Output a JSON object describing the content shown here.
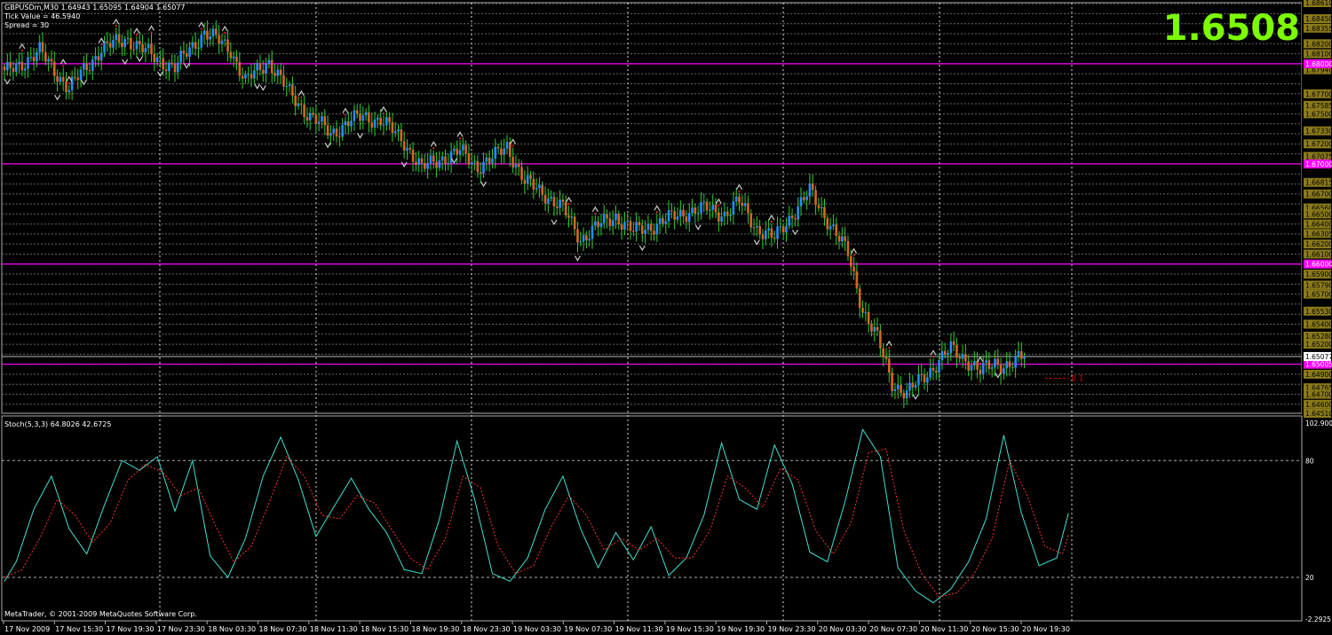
{
  "header": {
    "symbol_line": "GBPUSDm,M30  1.64943 1.65095 1.64904 1.65077",
    "tick_value": "Tick Value = 46.5940",
    "spread": "Spread = 30"
  },
  "big_price": "1.6508",
  "indicator_label": "Stoch(5,3,3) 64.8026 42.6725",
  "copyright": "MetaTrader, © 2001-2009 MetaQuotes Software Corp.",
  "order_label": "0.1",
  "colors": {
    "background": "#000000",
    "bull_candle": "#1E90FF",
    "bear_candle": "#D2691E",
    "wick": "#32CD32",
    "level_line": "#FF00FF",
    "grid": "#666666",
    "stoch_main": "#40E0D0",
    "stoch_signal": "#FF3030",
    "big_price": "#7CFC00"
  },
  "chart_data": [
    {
      "type": "candlestick",
      "ylim": [
        1.6451,
        1.6861
      ],
      "price_axis_labels": [
        "1.68610",
        "1.68450",
        "1.68355",
        "1.68200",
        "1.68100",
        "1.67940",
        "1.67700",
        "1.67585",
        "1.67500",
        "1.67330",
        "1.67200",
        "1.67075",
        "1.66815",
        "1.66700",
        "1.66560",
        "1.66500",
        "1.66400",
        "1.66305",
        "1.66200",
        "1.66100",
        "1.65900",
        "1.65790",
        "1.65700",
        "1.65530",
        "1.65400",
        "1.65280",
        "1.65200",
        "1.64900",
        "1.64765",
        "1.64700",
        "1.64600",
        "1.64510"
      ],
      "level_lines": [
        1.68,
        1.67,
        1.66,
        1.65
      ],
      "level_labels": [
        "1.68000",
        "1.67000",
        "1.66000",
        "1.65005"
      ],
      "current_price": 1.65077,
      "current_price_label": "1.65077",
      "time_labels": [
        "17 Nov 2009",
        "17 Nov 15:30",
        "17 Nov 19:30",
        "17 Nov 23:30",
        "18 Nov 03:30",
        "18 Nov 07:30",
        "18 Nov 11:30",
        "18 Nov 15:30",
        "18 Nov 19:30",
        "18 Nov 23:30",
        "19 Nov 03:30",
        "19 Nov 07:30",
        "19 Nov 11:30",
        "19 Nov 15:30",
        "19 Nov 19:30",
        "19 Nov 23:30",
        "20 Nov 03:30",
        "20 Nov 07:30",
        "20 Nov 11:30",
        "20 Nov 15:30",
        "20 Nov 19:30"
      ],
      "close_path": [
        [
          0,
          1.679
        ],
        [
          12,
          1.6812
        ],
        [
          22,
          1.6775
        ],
        [
          33,
          1.6815
        ],
        [
          42,
          1.6825
        ],
        [
          50,
          1.6808
        ],
        [
          58,
          1.6796
        ],
        [
          68,
          1.6832
        ],
        [
          77,
          1.6814
        ],
        [
          82,
          1.6782
        ],
        [
          90,
          1.6803
        ],
        [
          97,
          1.677
        ],
        [
          104,
          1.6748
        ],
        [
          111,
          1.673
        ],
        [
          117,
          1.6742
        ],
        [
          122,
          1.6747
        ],
        [
          128,
          1.6744
        ],
        [
          136,
          1.6722
        ],
        [
          142,
          1.6695
        ],
        [
          148,
          1.6705
        ],
        [
          155,
          1.6712
        ],
        [
          161,
          1.6698
        ],
        [
          166,
          1.6705
        ],
        [
          171,
          1.6718
        ],
        [
          177,
          1.6682
        ],
        [
          184,
          1.667
        ],
        [
          190,
          1.6655
        ],
        [
          196,
          1.6625
        ],
        [
          202,
          1.6638
        ],
        [
          208,
          1.6648
        ],
        [
          214,
          1.6632
        ],
        [
          220,
          1.6638
        ],
        [
          226,
          1.6645
        ],
        [
          233,
          1.6653
        ],
        [
          239,
          1.6655
        ],
        [
          245,
          1.665
        ],
        [
          250,
          1.6662
        ],
        [
          256,
          1.6636
        ],
        [
          262,
          1.6625
        ],
        [
          268,
          1.665
        ],
        [
          274,
          1.6672
        ],
        [
          281,
          1.664
        ],
        [
          287,
          1.661
        ],
        [
          292,
          1.6555
        ],
        [
          297,
          1.6525
        ],
        [
          302,
          1.6482
        ],
        [
          307,
          1.647
        ],
        [
          312,
          1.6486
        ],
        [
          317,
          1.65
        ],
        [
          322,
          1.6515
        ],
        [
          327,
          1.6506
        ],
        [
          332,
          1.6492
        ],
        [
          337,
          1.6502
        ],
        [
          342,
          1.6498
        ],
        [
          347,
          1.6508
        ]
      ],
      "up_fractals": [
        6,
        20,
        22,
        33,
        38,
        45,
        50,
        67,
        75,
        101,
        116,
        129,
        146,
        155,
        173,
        192,
        201,
        222,
        243,
        250,
        261,
        289,
        301,
        316,
        332
      ],
      "down_fractals": [
        1,
        18,
        27,
        41,
        46,
        53,
        62,
        86,
        88,
        110,
        121,
        136,
        153,
        163,
        187,
        195,
        217,
        236,
        256,
        269,
        310,
        338
      ]
    },
    {
      "type": "line",
      "title": "Stoch(5,3,3) 64.8026 42.6725",
      "ylim": [
        -2.2925,
        102.9
      ],
      "y_axis_labels": [
        "102.9000",
        "80",
        "20",
        "-2.2925"
      ],
      "levels": [
        80,
        20
      ],
      "series": [
        {
          "name": "Main",
          "points": [
            [
              0,
              18
            ],
            [
              4,
              28
            ],
            [
              10,
              55
            ],
            [
              16,
              72
            ],
            [
              22,
              45
            ],
            [
              28,
              32
            ],
            [
              34,
              57
            ],
            [
              40,
              80
            ],
            [
              46,
              75
            ],
            [
              52,
              82
            ],
            [
              58,
              54
            ],
            [
              64,
              80
            ],
            [
              70,
              31
            ],
            [
              76,
              20
            ],
            [
              82,
              40
            ],
            [
              88,
              72
            ],
            [
              94,
              92
            ],
            [
              100,
              70
            ],
            [
              106,
              41
            ],
            [
              112,
              56
            ],
            [
              118,
              71
            ],
            [
              124,
              55
            ],
            [
              130,
              43
            ],
            [
              136,
              24
            ],
            [
              142,
              22
            ],
            [
              148,
              50
            ],
            [
              154,
              90
            ],
            [
              160,
              60
            ],
            [
              166,
              22
            ],
            [
              172,
              18
            ],
            [
              178,
              30
            ],
            [
              184,
              55
            ],
            [
              190,
              72
            ],
            [
              196,
              45
            ],
            [
              202,
              25
            ],
            [
              208,
              43
            ],
            [
              214,
              29
            ],
            [
              220,
              46
            ],
            [
              226,
              21
            ],
            [
              232,
              30
            ],
            [
              238,
              52
            ],
            [
              244,
              89
            ],
            [
              250,
              60
            ],
            [
              256,
              55
            ],
            [
              262,
              88
            ],
            [
              268,
              68
            ],
            [
              274,
              33
            ],
            [
              280,
              28
            ],
            [
              286,
              59
            ],
            [
              292,
              96
            ],
            [
              298,
              82
            ],
            [
              304,
              25
            ],
            [
              310,
              13
            ],
            [
              316,
              7
            ],
            [
              322,
              14
            ],
            [
              328,
              28
            ],
            [
              334,
              50
            ],
            [
              340,
              93
            ],
            [
              346,
              53
            ],
            [
              352,
              26
            ],
            [
              358,
              30
            ],
            [
              362,
              53
            ]
          ]
        },
        {
          "name": "Signal",
          "points": [
            [
              0,
              20
            ],
            [
              6,
              24
            ],
            [
              12,
              40
            ],
            [
              18,
              60
            ],
            [
              24,
              52
            ],
            [
              30,
              38
            ],
            [
              36,
              48
            ],
            [
              42,
              70
            ],
            [
              48,
              78
            ],
            [
              54,
              74
            ],
            [
              60,
              62
            ],
            [
              66,
              66
            ],
            [
              72,
              46
            ],
            [
              78,
              28
            ],
            [
              84,
              36
            ],
            [
              90,
              58
            ],
            [
              96,
              82
            ],
            [
              102,
              72
            ],
            [
              108,
              52
            ],
            [
              114,
              50
            ],
            [
              120,
              62
            ],
            [
              126,
              58
            ],
            [
              132,
              44
            ],
            [
              138,
              30
            ],
            [
              144,
              24
            ],
            [
              150,
              40
            ],
            [
              156,
              72
            ],
            [
              162,
              66
            ],
            [
              168,
              36
            ],
            [
              174,
              22
            ],
            [
              180,
              26
            ],
            [
              186,
              46
            ],
            [
              192,
              62
            ],
            [
              198,
              52
            ],
            [
              204,
              34
            ],
            [
              210,
              40
            ],
            [
              216,
              34
            ],
            [
              222,
              40
            ],
            [
              228,
              30
            ],
            [
              234,
              30
            ],
            [
              240,
              44
            ],
            [
              246,
              72
            ],
            [
              252,
              66
            ],
            [
              258,
              56
            ],
            [
              264,
              76
            ],
            [
              270,
              70
            ],
            [
              276,
              44
            ],
            [
              282,
              32
            ],
            [
              288,
              48
            ],
            [
              294,
              84
            ],
            [
              300,
              86
            ],
            [
              306,
              44
            ],
            [
              312,
              22
            ],
            [
              318,
              10
            ],
            [
              324,
              12
            ],
            [
              330,
              22
            ],
            [
              336,
              40
            ],
            [
              342,
              80
            ],
            [
              348,
              62
            ],
            [
              354,
              36
            ],
            [
              360,
              32
            ],
            [
              362,
              42
            ]
          ]
        }
      ]
    }
  ]
}
